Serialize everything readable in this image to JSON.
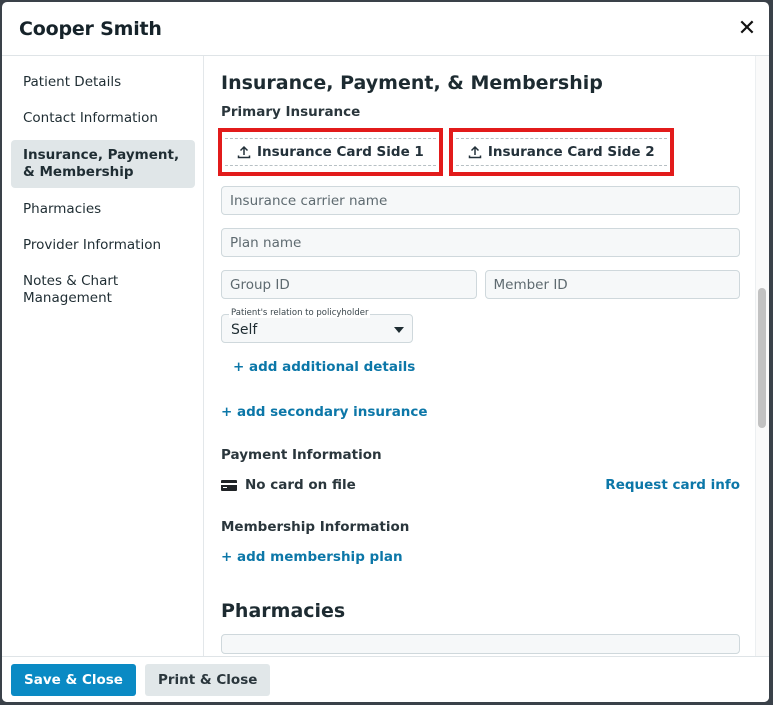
{
  "modal": {
    "title": "Cooper Smith",
    "close_icon": "close-icon"
  },
  "sidebar": {
    "items": [
      {
        "label": "Patient Details",
        "active": false
      },
      {
        "label": "Contact Information",
        "active": false
      },
      {
        "label": "Insurance, Payment, & Membership",
        "active": true
      },
      {
        "label": "Pharmacies",
        "active": false
      },
      {
        "label": "Provider Information",
        "active": false
      },
      {
        "label": "Notes & Chart Management",
        "active": false
      }
    ]
  },
  "content": {
    "section_title": "Insurance, Payment, & Membership",
    "primary_insurance_label": "Primary Insurance",
    "upload_buttons": [
      {
        "label": "Insurance Card Side 1",
        "icon": "upload-icon"
      },
      {
        "label": "Insurance Card Side 2",
        "icon": "upload-icon"
      }
    ],
    "fields": {
      "carrier_placeholder": "Insurance carrier name",
      "plan_placeholder": "Plan name",
      "group_placeholder": "Group ID",
      "member_placeholder": "Member ID"
    },
    "relation_select": {
      "legend": "Patient's relation to policyholder",
      "value": "Self"
    },
    "add_additional_details": "+ add additional details",
    "add_secondary_insurance": "+ add secondary insurance",
    "payment": {
      "title": "Payment Information",
      "card_icon": "credit-card-icon",
      "status": "No card on file",
      "request_link": "Request card info"
    },
    "membership": {
      "title": "Membership Information",
      "add_link": "+ add membership plan"
    },
    "pharmacies_title": "Pharmacies"
  },
  "footer": {
    "save_label": "Save & Close",
    "print_label": "Print & Close"
  },
  "colors": {
    "primary": "#0a8ac4",
    "link": "#0c77a8",
    "highlight_outline": "#e21b1b"
  }
}
